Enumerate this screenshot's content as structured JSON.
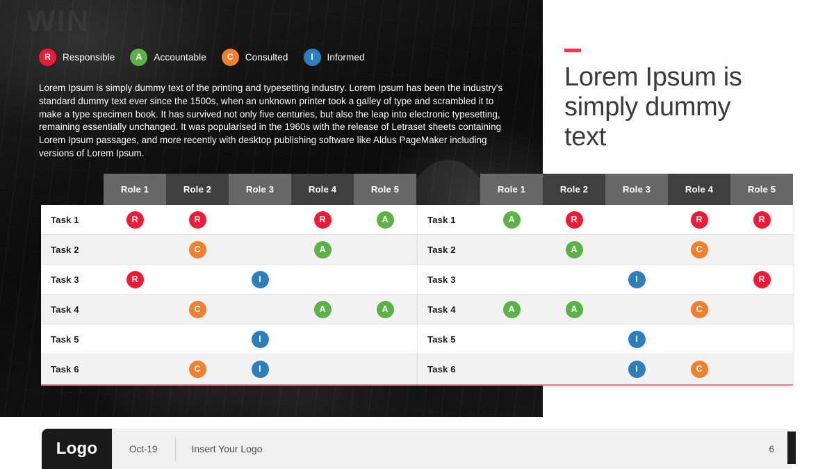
{
  "background": {
    "photo_overlay_word": "WIN"
  },
  "legend": {
    "items": [
      {
        "code": "R",
        "label": "Responsible",
        "color": "#ED1B35"
      },
      {
        "code": "A",
        "label": "Accountable",
        "color": "#5CB246"
      },
      {
        "code": "C",
        "label": "Consulted",
        "color": "#EE8030"
      },
      {
        "code": "I",
        "label": "Informed",
        "color": "#2E7EBD"
      }
    ]
  },
  "body": {
    "paragraph": "Lorem Ipsum is simply dummy text of the printing and typesetting industry. Lorem Ipsum has been the industry's standard dummy text ever since the 1500s, when an unknown printer took a galley of type and scrambled it to make a type specimen book. It has survived not only five centuries, but also the leap into electronic typesetting, remaining essentially unchanged. It was popularised in the 1960s with the release of Letraset sheets containing Lorem Ipsum passages, and more recently with desktop publishing software like Aldus PageMaker including versions of Lorem Ipsum."
  },
  "title": {
    "heading": "Lorem Ipsum is simply dummy text",
    "accent_color": "#EE3A46"
  },
  "tables": [
    {
      "id": "raci-table-left",
      "columns": [
        "Role 1",
        "Role 2",
        "Role 3",
        "Role 4",
        "Role 5"
      ],
      "rows": [
        {
          "task": "Task 1",
          "cells": [
            "R",
            "R",
            "",
            "R",
            "A"
          ]
        },
        {
          "task": "Task 2",
          "cells": [
            "",
            "C",
            "",
            "A",
            ""
          ]
        },
        {
          "task": "Task 3",
          "cells": [
            "R",
            "",
            "I",
            "",
            ""
          ]
        },
        {
          "task": "Task 4",
          "cells": [
            "",
            "C",
            "",
            "A",
            "A"
          ]
        },
        {
          "task": "Task 5",
          "cells": [
            "",
            "",
            "I",
            "",
            ""
          ]
        },
        {
          "task": "Task 6",
          "cells": [
            "",
            "C",
            "I",
            "",
            ""
          ]
        }
      ]
    },
    {
      "id": "raci-table-right",
      "columns": [
        "Role 1",
        "Role 2",
        "Role 3",
        "Role 4",
        "Role 5"
      ],
      "rows": [
        {
          "task": "Task 1",
          "cells": [
            "A",
            "R",
            "",
            "R",
            "R"
          ]
        },
        {
          "task": "Task 2",
          "cells": [
            "",
            "A",
            "",
            "C",
            ""
          ]
        },
        {
          "task": "Task 3",
          "cells": [
            "",
            "",
            "I",
            "",
            "R"
          ]
        },
        {
          "task": "Task 4",
          "cells": [
            "A",
            "A",
            "",
            "C",
            ""
          ]
        },
        {
          "task": "Task 5",
          "cells": [
            "",
            "",
            "I",
            "",
            ""
          ]
        },
        {
          "task": "Task 6",
          "cells": [
            "",
            "",
            "I",
            "C",
            ""
          ]
        }
      ]
    }
  ],
  "footer": {
    "logo": "Logo",
    "date": "Oct-19",
    "tagline": "Insert Your Logo",
    "page_number": "6"
  }
}
